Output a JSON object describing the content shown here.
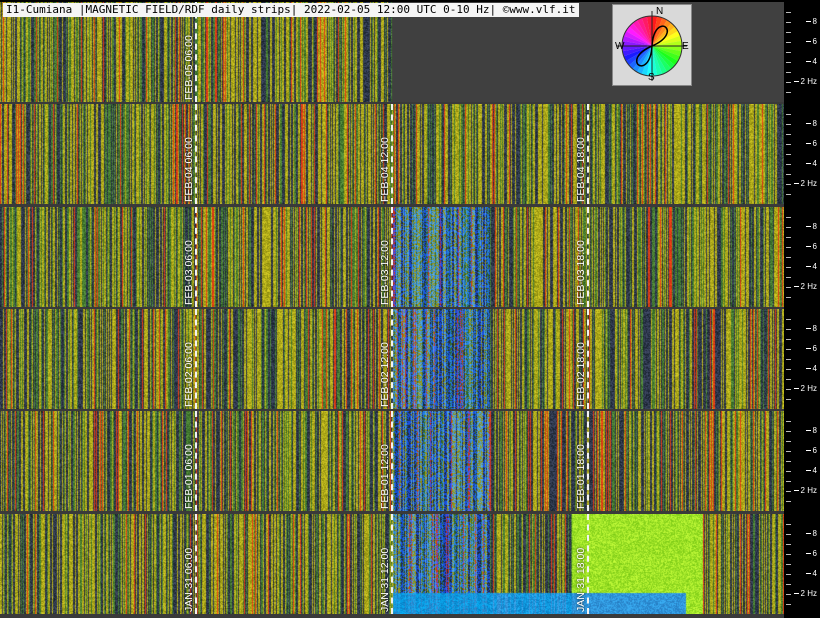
{
  "header": {
    "title": "I1-Cumiana |MAGNETIC FIELD/RDF daily strips| 2022-02-05 12:00 UTC 0-10 Hz| ©www.vlf.it"
  },
  "compass": {
    "north": "N",
    "south": "S",
    "east": "E",
    "west": "W"
  },
  "scale": {
    "ticks": [
      {
        "value": 8,
        "label": "8"
      },
      {
        "value": 6,
        "label": "6"
      },
      {
        "value": 4,
        "label": "4"
      },
      {
        "value": 2,
        "label": "2 Hz"
      }
    ]
  },
  "chart_data": {
    "type": "heatmap",
    "title": "I1-Cumiana |MAGNETIC FIELD/RDF daily strips| 2022-02-05 12:00 UTC 0-10 Hz| ©www.vlf.it",
    "ylim": [
      0,
      10
    ],
    "y_unit": "Hz",
    "strips": [
      {
        "day": "FEB-05",
        "coverage_hours": [
          0,
          12
        ],
        "markers": [
          "FEB-05 06:00"
        ]
      },
      {
        "day": "FEB-04",
        "coverage_hours": [
          0,
          24
        ],
        "markers": [
          "FEB-04 06:00",
          "FEB-04 12:00",
          "FEB-04 18:00"
        ]
      },
      {
        "day": "FEB-03",
        "coverage_hours": [
          0,
          24
        ],
        "markers": [
          "FEB-03 06:00",
          "FEB-03 12:00",
          "FEB-03 18:00"
        ]
      },
      {
        "day": "FEB-02",
        "coverage_hours": [
          0,
          24
        ],
        "markers": [
          "FEB-02 06:00",
          "FEB-02 12:00",
          "FEB-02 18:00"
        ]
      },
      {
        "day": "FEB-01",
        "coverage_hours": [
          0,
          24
        ],
        "markers": [
          "FEB-01 06:00",
          "FEB-01 12:00",
          "FEB-01 18:00"
        ]
      },
      {
        "day": "JAN-31",
        "coverage_hours": [
          0,
          24
        ],
        "markers": [
          "JAN-31 06:00",
          "JAN-31 12:00",
          "JAN-31 18:00"
        ]
      }
    ],
    "colors": {
      "background": "#000000",
      "empty": "#404040",
      "separator": "#3a3a3a"
    }
  }
}
